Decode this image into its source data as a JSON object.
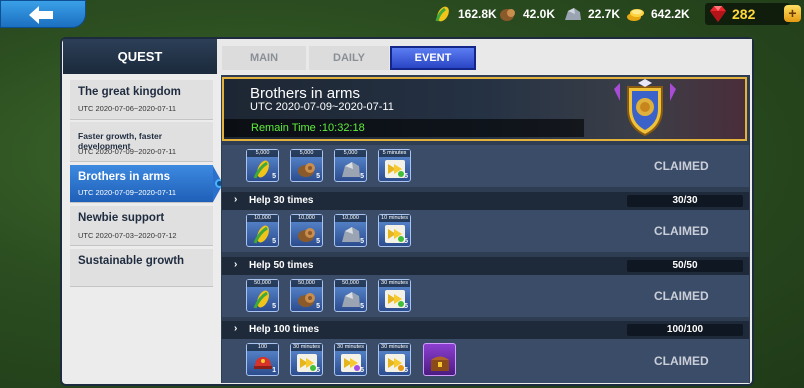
{
  "topbar": {
    "resources": [
      {
        "icon": "corn-icon",
        "value": "162.8K"
      },
      {
        "icon": "wood-icon",
        "value": "42.0K"
      },
      {
        "icon": "stone-icon",
        "value": "22.7K"
      },
      {
        "icon": "gold-coins-icon",
        "value": "642.2K"
      }
    ],
    "gems": "282",
    "plus": "+"
  },
  "panel": {
    "title": "QUEST",
    "tabs": [
      {
        "label": "MAIN",
        "active": false
      },
      {
        "label": "DAILY",
        "active": false
      },
      {
        "label": "EVENT",
        "active": true
      }
    ]
  },
  "quests": [
    {
      "title": "The great kingdom",
      "date": "UTC 2020-07-06~2020-07-11"
    },
    {
      "title": "Faster growth, faster development",
      "date": "UTC 2020-07-09~2020-07-11"
    },
    {
      "title": "Brothers in arms",
      "date": "UTC 2020-07-09~2020-07-11",
      "active": true
    },
    {
      "title": "Newbie support",
      "date": "UTC 2020-07-03~2020-07-12"
    },
    {
      "title": "Sustainable growth",
      "date": ""
    }
  ],
  "banner": {
    "title": "Brothers in arms",
    "date": "UTC 2020-07-09~2020-07-11",
    "remain": "Remain Time :10:32:18"
  },
  "tasks": [
    {
      "label": "",
      "progress": "",
      "status": "CLAIMED",
      "rewards": [
        {
          "kind": "corn",
          "top": "5,000",
          "count": "5"
        },
        {
          "kind": "wood",
          "top": "5,000",
          "count": "5"
        },
        {
          "kind": "stone",
          "top": "5,000",
          "count": "5"
        },
        {
          "kind": "speedup",
          "top": "5 minutes",
          "count": "5"
        }
      ]
    },
    {
      "label": "Help 30 times",
      "progress": "30/30",
      "status": "CLAIMED",
      "rewards": [
        {
          "kind": "corn",
          "top": "10,000",
          "count": "5"
        },
        {
          "kind": "wood",
          "top": "10,000",
          "count": "5"
        },
        {
          "kind": "stone",
          "top": "10,000",
          "count": "5"
        },
        {
          "kind": "speedup",
          "top": "10 minutes",
          "count": "5"
        }
      ]
    },
    {
      "label": "Help 50 times",
      "progress": "50/50",
      "status": "CLAIMED",
      "rewards": [
        {
          "kind": "corn",
          "top": "50,000",
          "count": "5"
        },
        {
          "kind": "wood",
          "top": "50,000",
          "count": "5"
        },
        {
          "kind": "stone",
          "top": "50,000",
          "count": "5"
        },
        {
          "kind": "speedup",
          "top": "30 minutes",
          "count": "5"
        }
      ]
    },
    {
      "label": "Help 100 times",
      "progress": "100/100",
      "status": "CLAIMED",
      "rewards": [
        {
          "kind": "helmet",
          "top": "100",
          "count": "1"
        },
        {
          "kind": "speedup",
          "top": "30 minutes",
          "count": "5"
        },
        {
          "kind": "speedup-purple",
          "top": "30 minutes",
          "count": "5"
        },
        {
          "kind": "speedup-gold",
          "top": "30 minutes",
          "count": "5"
        },
        {
          "kind": "chest",
          "top": "",
          "count": ""
        }
      ]
    }
  ]
}
